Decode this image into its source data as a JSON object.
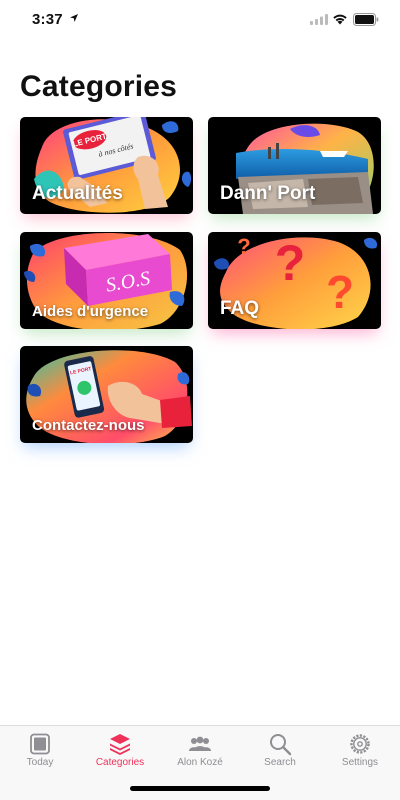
{
  "status": {
    "time": "3:37"
  },
  "page": {
    "title": "Categories"
  },
  "cards": [
    {
      "label": "Actualités"
    },
    {
      "label": "Dann' Port"
    },
    {
      "label": "Aides d'urgence"
    },
    {
      "label": "FAQ"
    },
    {
      "label": "Contactez-nous"
    }
  ],
  "art_text": {
    "le_port": "LE PORT",
    "a_nos_cotes": "à nos côtés",
    "sos": "S.O.S",
    "phone_label": "LE PORT"
  },
  "tabs": [
    {
      "label": "Today",
      "icon": "today-icon"
    },
    {
      "label": "Categories",
      "icon": "categories-icon",
      "active": true
    },
    {
      "label": "Alon Kozé",
      "icon": "people-icon"
    },
    {
      "label": "Search",
      "icon": "search-icon"
    },
    {
      "label": "Settings",
      "icon": "gear-icon"
    }
  ],
  "colors": {
    "accent": "#f0325a",
    "inactive": "#8e8e93"
  }
}
